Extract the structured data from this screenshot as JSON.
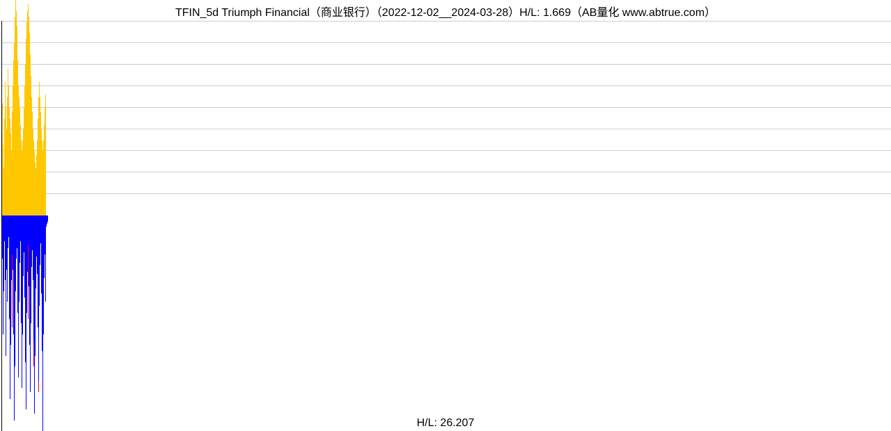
{
  "title": "TFIN_5d Triumph Financial（商业银行）（2022-12-02__2024-03-28）H/L: 1.669（AB量化  www.abtrue.com）",
  "subtitle": "H/L: 26.207",
  "chart_data": {
    "type": "bar",
    "title": "TFIN_5d Triumph Financial（商业银行）（2022-12-02__2024-03-28）H/L: 1.669（AB量化  www.abtrue.com）",
    "subtitle": "H/L: 26.207",
    "hl_ratio_upper": 1.669,
    "hl_ratio_lower": 26.207,
    "date_range": [
      "2022-12-02",
      "2024-03-28"
    ],
    "upper_panel": {
      "ylim": [
        0,
        1.0
      ],
      "gridlines": [
        0.1,
        0.2,
        0.3,
        0.4,
        0.5,
        0.6,
        0.7,
        0.8,
        0.9
      ],
      "series": [
        {
          "name": "upper-yellow",
          "color": "#ffc700",
          "values": [
            0.52,
            0.33,
            0.22,
            0.45,
            0.62,
            0.5,
            0.4,
            0.55,
            0.68,
            0.6,
            0.5,
            0.45,
            0.38,
            0.3,
            0.48,
            0.6,
            0.72,
            0.8,
            0.92,
            1.0,
            0.95,
            0.88,
            0.72,
            0.6,
            0.55,
            0.5,
            0.42,
            0.35,
            0.3,
            0.35,
            0.4,
            0.5,
            0.6,
            0.7,
            0.82,
            0.9,
            0.95,
            0.98,
            0.92,
            0.85,
            0.75,
            0.65,
            0.55,
            0.48,
            0.4,
            0.35,
            0.3,
            0.25,
            0.22,
            0.28,
            0.35,
            0.45,
            0.55,
            0.62,
            0.55,
            0.48,
            0.4,
            0.35,
            0.3,
            0.35,
            0.42,
            0.5,
            0.56,
            0.0,
            0.0,
            0.0
          ]
        },
        {
          "name": "upper-red",
          "color": "#ff0000",
          "values": [
            0.35,
            0.2,
            0.12,
            0.1,
            0.08
          ]
        }
      ]
    },
    "lower_panel": {
      "ylim": [
        0,
        1.0
      ],
      "series": [
        {
          "name": "lower-blue",
          "color": "#0000ff",
          "values": [
            0.2,
            0.55,
            0.35,
            0.12,
            0.3,
            0.65,
            0.25,
            0.4,
            0.15,
            0.1,
            0.48,
            0.85,
            0.6,
            0.3,
            0.18,
            0.25,
            0.55,
            0.95,
            0.7,
            0.35,
            0.2,
            0.15,
            0.45,
            0.75,
            0.4,
            0.22,
            0.12,
            0.5,
            0.8,
            0.55,
            0.28,
            0.17,
            0.38,
            0.68,
            0.9,
            0.45,
            0.26,
            0.14,
            0.33,
            0.6,
            0.82,
            0.5,
            0.24,
            0.16,
            0.3,
            0.58,
            0.92,
            0.65,
            0.34,
            0.19,
            0.27,
            0.52,
            0.77,
            0.42,
            0.23,
            0.13,
            0.36,
            0.63,
            1.0,
            0.55,
            0.29,
            0.18,
            0.4,
            0.05,
            0.04,
            0.03
          ]
        },
        {
          "name": "lower-red",
          "color": "#ff0000",
          "values_sparse": [
            {
              "i": 14,
              "v": 0.52
            },
            {
              "i": 23,
              "v": 0.6
            },
            {
              "i": 37,
              "v": 0.48
            },
            {
              "i": 45,
              "v": 0.7
            },
            {
              "i": 52,
              "v": 0.82
            }
          ]
        }
      ]
    }
  }
}
